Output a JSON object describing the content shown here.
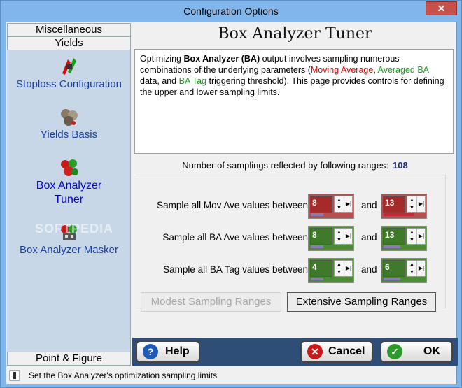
{
  "window": {
    "title": "Configuration Options",
    "close_label": "✕"
  },
  "nav": {
    "tabs": {
      "misc": "Miscellaneous",
      "yields": "Yields",
      "point_figure": "Point & Figure"
    },
    "items": [
      {
        "label": "Stoploss Configuration",
        "icon": "stoploss-icon"
      },
      {
        "label": "Yields Basis",
        "icon": "yields-basis-icon"
      },
      {
        "label": "Box Analyzer Tuner",
        "icon": "box-analyzer-tuner-icon",
        "active": true
      },
      {
        "label": "Box Analyzer Masker",
        "icon": "box-analyzer-masker-icon"
      }
    ],
    "watermark": "SOFTPEDIA"
  },
  "pane": {
    "title": "Box Analyzer Tuner",
    "description": {
      "p1": "Optimizing ",
      "bold1": "Box Analyzer (BA)",
      "p2": " output involves sampling numerous combinations of the underlying parameters (",
      "ma": "Moving Average",
      "sep1": ", ",
      "aba": "Averaged BA",
      "p3": " data, and ",
      "bat": "BA Tag",
      "p4": " triggering threshold). This page provides controls for defining the upper and lower sampling limits."
    },
    "samplings_label": "Number of samplings reflected by following ranges:",
    "samplings_count": "108",
    "rows": [
      {
        "label": "Sample all Mov Ave values between",
        "low": "8",
        "high": "13",
        "and": "and"
      },
      {
        "label": "Sample all BA Ave values between",
        "low": "8",
        "high": "13",
        "and": "and"
      },
      {
        "label": "Sample all BA Tag values between",
        "low": "4",
        "high": "6",
        "and": "and"
      }
    ],
    "modest_button": "Modest Sampling Ranges",
    "extensive_button": "Extensive Sampling Ranges"
  },
  "buttons": {
    "help": "Help",
    "cancel": "Cancel",
    "ok": "OK"
  },
  "status": {
    "text": "Set the Box Analyzer's optimization sampling limits"
  },
  "colors": {
    "accent_red": "#a52a2a",
    "accent_green": "#3e7a2a",
    "bottom_bar": "#2e4e78"
  }
}
